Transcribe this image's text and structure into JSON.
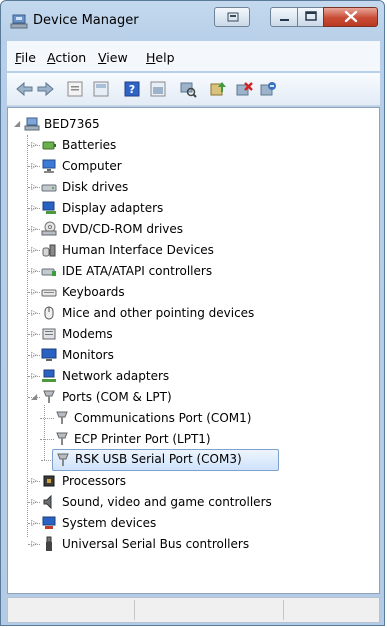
{
  "window": {
    "title": "Device Manager"
  },
  "menu": [
    "File",
    "Action",
    "View",
    "Help"
  ],
  "toolbar_icons": [
    "back-icon",
    "forward-icon",
    "properties-icon",
    "show-hide-icon",
    "help-icon",
    "device-view-icon",
    "scan-hardware-icon",
    "update-driver-icon",
    "uninstall-icon",
    "disable-icon"
  ],
  "tree": {
    "root": "BED7365",
    "categories": [
      {
        "label": "Batteries",
        "icon": "battery-icon",
        "expanded": false
      },
      {
        "label": "Computer",
        "icon": "computer-icon",
        "expanded": false
      },
      {
        "label": "Disk drives",
        "icon": "disk-drive-icon",
        "expanded": false
      },
      {
        "label": "Display adapters",
        "icon": "display-adapter-icon",
        "expanded": false
      },
      {
        "label": "DVD/CD-ROM drives",
        "icon": "dvd-drive-icon",
        "expanded": false
      },
      {
        "label": "Human Interface Devices",
        "icon": "hid-icon",
        "expanded": false
      },
      {
        "label": "IDE ATA/ATAPI controllers",
        "icon": "ide-controller-icon",
        "expanded": false
      },
      {
        "label": "Keyboards",
        "icon": "keyboard-icon",
        "expanded": false
      },
      {
        "label": "Mice and other pointing devices",
        "icon": "mouse-icon",
        "expanded": false
      },
      {
        "label": "Modems",
        "icon": "modem-icon",
        "expanded": false
      },
      {
        "label": "Monitors",
        "icon": "monitor-icon",
        "expanded": false
      },
      {
        "label": "Network adapters",
        "icon": "network-adapter-icon",
        "expanded": false
      },
      {
        "label": "Ports (COM & LPT)",
        "icon": "port-icon",
        "expanded": true,
        "children": [
          "Communications Port (COM1)",
          "ECP Printer Port (LPT1)",
          "RSK USB Serial Port (COM3)"
        ],
        "selected_child": "RSK USB Serial Port (COM3)"
      },
      {
        "label": "Processors",
        "icon": "processor-icon",
        "expanded": false
      },
      {
        "label": "Sound, video and game controllers",
        "icon": "sound-icon",
        "expanded": false
      },
      {
        "label": "System devices",
        "icon": "system-devices-icon",
        "expanded": false
      },
      {
        "label": "Universal Serial Bus controllers",
        "icon": "usb-icon",
        "expanded": false
      }
    ]
  },
  "colors": {
    "selection_bg": "#cfe3fb",
    "selection_border": "#7da2ce",
    "close_button": "#c94b35"
  }
}
